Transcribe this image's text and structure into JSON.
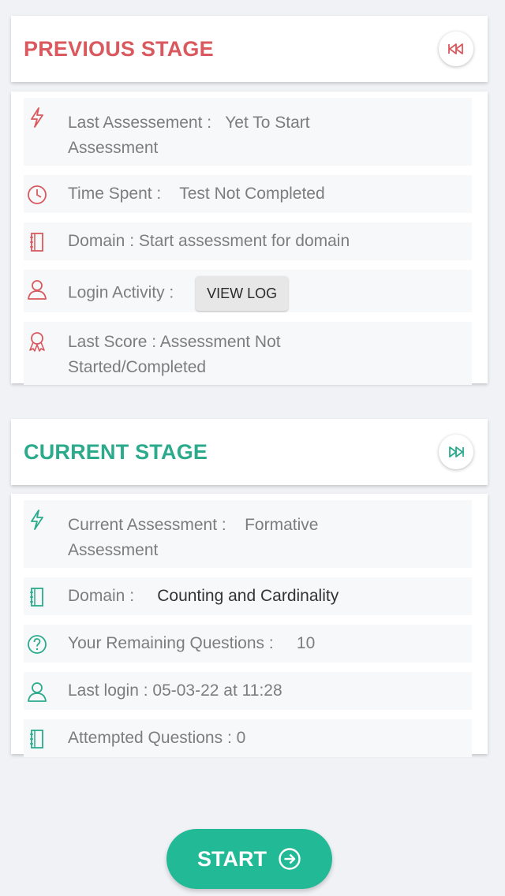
{
  "colors": {
    "previous_accent": "#d9595e",
    "current_accent": "#2bab8c",
    "start_button": "#22b996"
  },
  "previous_stage": {
    "title": "PREVIOUS STAGE",
    "header_icon": "rewind-icon",
    "rows": [
      {
        "icon": "bolt-icon",
        "label": "Last Assessement :",
        "value": "Yet To Start",
        "value_cont": "Assessment"
      },
      {
        "icon": "clock-icon",
        "label": "Time Spent :",
        "value": "Test Not Completed"
      },
      {
        "icon": "notebook-icon",
        "label": "Domain : Start assessment for domain"
      },
      {
        "icon": "user-icon",
        "label": "Login Activity :",
        "button": "VIEW LOG"
      },
      {
        "icon": "award-icon",
        "label": "Last Score : Assessment Not",
        "label_cont": "Started/Completed"
      }
    ]
  },
  "current_stage": {
    "title": "CURRENT STAGE",
    "header_icon": "fast-forward-icon",
    "rows": [
      {
        "icon": "bolt-icon",
        "label": "Current Assessment :",
        "value": "Formative",
        "value_cont": "Assessment"
      },
      {
        "icon": "notebook-icon",
        "label": "Domain :",
        "value": "Counting and Cardinality"
      },
      {
        "icon": "question-icon",
        "label": "Your Remaining Questions :",
        "value": "10"
      },
      {
        "icon": "user-icon",
        "label": "Last login : 05-03-22 at 11:28"
      },
      {
        "icon": "notebook-icon",
        "label": "Attempted Questions : 0"
      }
    ]
  },
  "start_button": {
    "label": "START",
    "icon": "arrow-circle-right-icon"
  }
}
